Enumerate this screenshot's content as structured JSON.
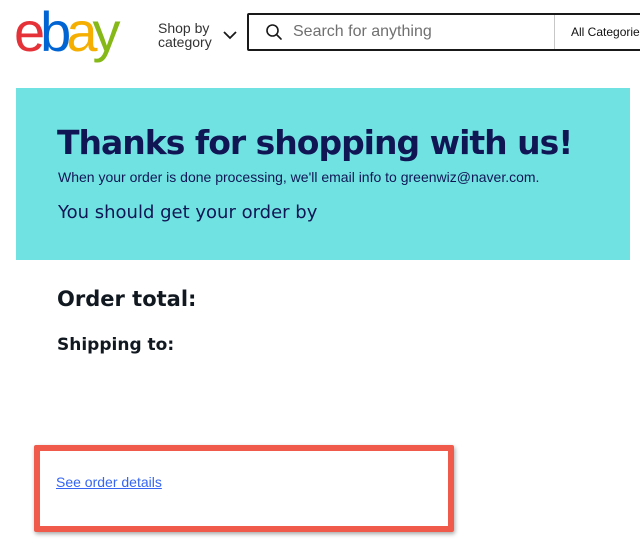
{
  "header": {
    "logo": {
      "letters": [
        "e",
        "b",
        "a",
        "y"
      ],
      "colors": [
        "#e53238",
        "#0064d2",
        "#f5af02",
        "#86b817"
      ]
    },
    "shop_by_category": "Shop by category",
    "search": {
      "placeholder": "Search for anything",
      "value": ""
    },
    "category_select": "All Categories"
  },
  "banner": {
    "title": "Thanks for shopping with us!",
    "email_note": "When your order is done processing, we'll email info to greenwiz@naver.com.",
    "delivery": "You should get your order by",
    "background": "#71e2e2",
    "text_color": "#101554"
  },
  "order": {
    "total_label": "Order total:",
    "shipping_label": "Shipping to:"
  },
  "links": {
    "see_order_details": "See order details"
  },
  "highlight": {
    "color": "#f05a4a"
  }
}
